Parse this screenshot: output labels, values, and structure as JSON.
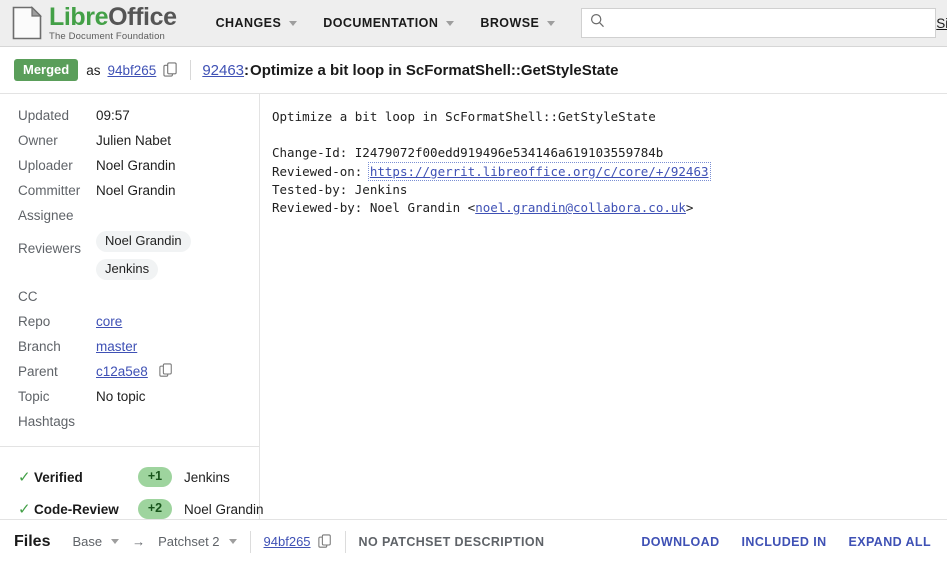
{
  "header": {
    "logo": {
      "name_green": "Libre",
      "name_dark": "Office",
      "tagline": "The Document Foundation"
    },
    "nav": [
      {
        "label": "CHANGES",
        "has_caret": true
      },
      {
        "label": "DOCUMENTATION",
        "has_caret": true
      },
      {
        "label": "BROWSE",
        "has_caret": true
      }
    ],
    "search": {
      "value": "",
      "placeholder": ""
    },
    "sign_in": "Sign in"
  },
  "change": {
    "status": "Merged",
    "as_word": "as",
    "merged_sha": "94bf265",
    "number": "92463",
    "colon": ":",
    "subject": "Optimize a bit loop in ScFormatShell::GetStyleState"
  },
  "sidebar": {
    "meta": [
      {
        "label": "Updated",
        "value": "09:57",
        "type": "text"
      },
      {
        "label": "Owner",
        "value": "Julien Nabet",
        "type": "text"
      },
      {
        "label": "Uploader",
        "value": "Noel Grandin",
        "type": "text"
      },
      {
        "label": "Committer",
        "value": "Noel Grandin",
        "type": "text"
      },
      {
        "label": "Assignee",
        "value": "",
        "type": "text"
      },
      {
        "label": "Reviewers",
        "value": "",
        "type": "chips",
        "chips": [
          "Noel Grandin",
          "Jenkins"
        ]
      },
      {
        "label": "CC",
        "value": "",
        "type": "text"
      },
      {
        "label": "Repo",
        "value": "core",
        "type": "link"
      },
      {
        "label": "Branch",
        "value": "master",
        "type": "link"
      },
      {
        "label": "Parent",
        "value": "c12a5e8",
        "type": "link-copy"
      },
      {
        "label": "Topic",
        "value": "No topic",
        "type": "text"
      },
      {
        "label": "Hashtags",
        "value": "",
        "type": "text"
      }
    ],
    "labels": [
      {
        "name": "Verified",
        "vote": "+1",
        "voter": "Jenkins",
        "approved": true
      },
      {
        "name": "Code-Review",
        "vote": "+2",
        "voter": "Noel Grandin",
        "approved": true
      }
    ]
  },
  "main": {
    "commit_line_1": "Optimize a bit loop in ScFormatShell::GetStyleState",
    "commit_blank": "",
    "change_id_line": "Change-Id: I2479072f00edd919496e534146a619103559784b",
    "reviewed_on_label": "Reviewed-on: ",
    "reviewed_on_url": "https://gerrit.libreoffice.org/c/core/+/92463",
    "tested_by_line": "Tested-by: Jenkins",
    "reviewed_by_prefix": "Reviewed-by: Noel Grandin <",
    "reviewed_by_email": "noel.grandin@collabora.co.uk",
    "reviewed_by_suffix": ">"
  },
  "files": {
    "title": "Files",
    "base_label": "Base",
    "arrow": "→",
    "patchset_label": "Patchset 2",
    "sha": "94bf265",
    "no_description": "NO PATCHSET DESCRIPTION",
    "actions": [
      "DOWNLOAD",
      "INCLUDED IN",
      "EXPAND ALL"
    ]
  },
  "colors": {
    "merged_green": "#5a9e5a",
    "vote_green": "#9ed49e",
    "link_blue": "#3f51b5",
    "logo_green": "#43a047",
    "header_bg": "#eeeeee"
  }
}
